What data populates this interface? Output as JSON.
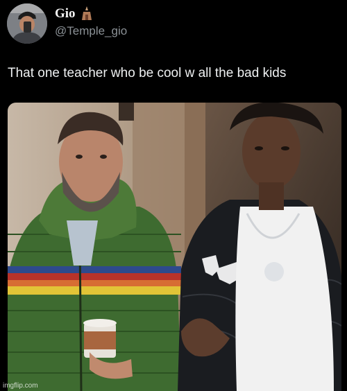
{
  "tweet": {
    "display_name": "Gio",
    "name_emoji": "⛩",
    "handle": "@Temple_gio",
    "text": "That one teacher who be cool w all the bad kids"
  },
  "photo": {
    "watermark": "imgflip.com"
  },
  "colors": {
    "background": "#000000",
    "text": "#e7e9ea",
    "handle": "#8b9196"
  }
}
